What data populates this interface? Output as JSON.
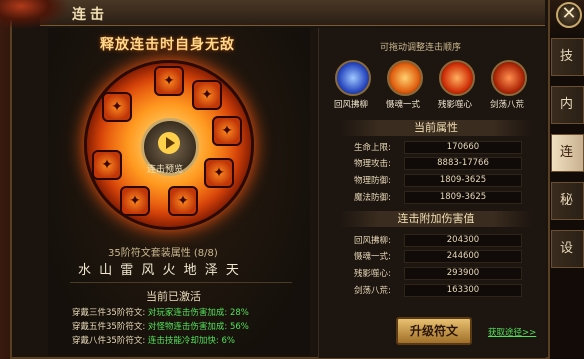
{
  "window": {
    "title": "连击"
  },
  "close_icon": "close-icon",
  "headline": "释放连击时自身无敌",
  "wheel": {
    "center_label": "连击预览"
  },
  "set": {
    "title": "35阶符文套装属性 (8/8)",
    "elements": "水 山 雷 风 火 地 泽 天"
  },
  "active": {
    "title": "当前已激活",
    "bonuses": [
      {
        "prefix": "穿戴三件35阶符文:",
        "effect": "对玩家连击伤害加成: 28%"
      },
      {
        "prefix": "穿戴五件35阶符文:",
        "effect": "对怪物连击伤害加成: 56%"
      },
      {
        "prefix": "穿戴八件35阶符文:",
        "effect": "连击技能冷却加快: 6%"
      }
    ]
  },
  "right": {
    "drag_hint": "可拖动调整连击顺序",
    "skills": [
      {
        "label": "回风拂柳",
        "icon": "blue-whirl-icon",
        "color": "#3a6aff"
      },
      {
        "label": "慑魂一式",
        "icon": "orange-slash-icon",
        "color": "#ff7a10"
      },
      {
        "label": "残影噬心",
        "icon": "fire-orb-icon",
        "color": "#ff4010"
      },
      {
        "label": "剑荡八荒",
        "icon": "flame-arc-icon",
        "color": "#e04010"
      }
    ],
    "attr_title": "当前属性",
    "attributes": [
      {
        "label": "生命上限:",
        "value": "170660"
      },
      {
        "label": "物理攻击:",
        "value": "8883-17766"
      },
      {
        "label": "物理防御:",
        "value": "1809-3625"
      },
      {
        "label": "魔法防御:",
        "value": "1809-3625"
      }
    ],
    "dmg_title": "连击附加伤害值",
    "damage": [
      {
        "label": "回风拂柳:",
        "value": "204300"
      },
      {
        "label": "慑魂一式:",
        "value": "244600"
      },
      {
        "label": "残影噬心:",
        "value": "293900"
      },
      {
        "label": "剑荡八荒:",
        "value": "163300"
      }
    ],
    "upgrade_label": "升级符文",
    "obtain_label": "获取途径>>"
  },
  "side_tabs": [
    {
      "label": "技能",
      "active": false
    },
    {
      "label": "内功",
      "active": false
    },
    {
      "label": "连击",
      "active": true
    },
    {
      "label": "秘籍",
      "active": false
    },
    {
      "label": "设置",
      "active": false
    }
  ]
}
